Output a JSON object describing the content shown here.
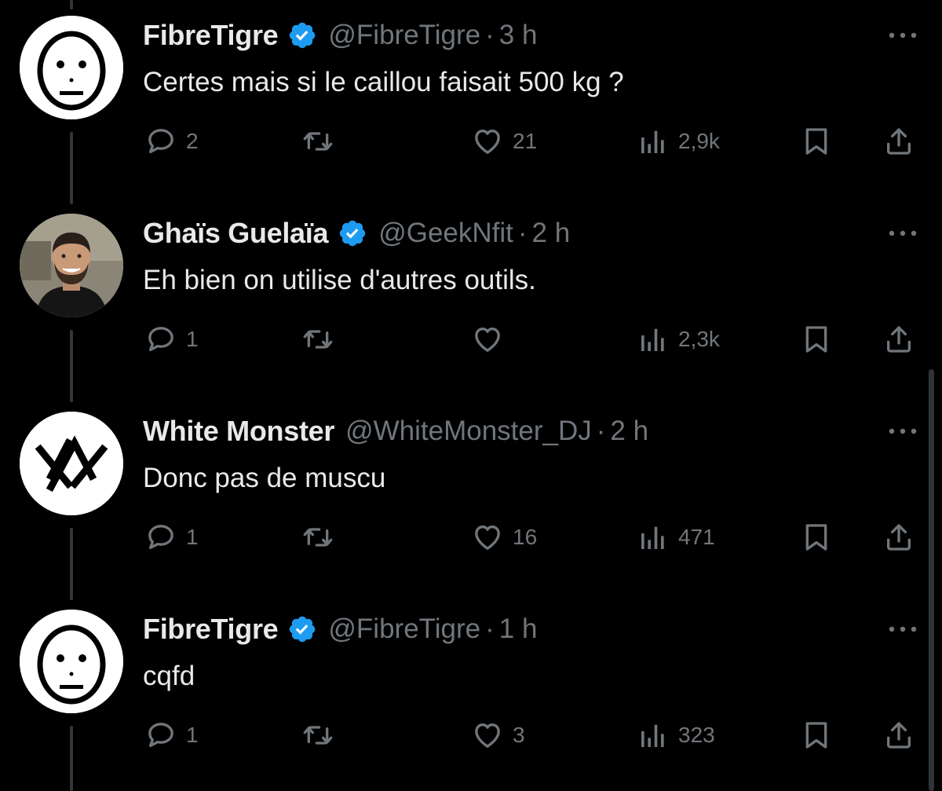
{
  "theme": {
    "background": "#000000",
    "text": "#e7e9ea",
    "muted": "#71767b",
    "verified": "#1d9bf0",
    "thread_line": "#333639"
  },
  "icons": {
    "reply": "speech-bubble-icon",
    "retweet": "retweet-icon",
    "like": "heart-icon",
    "views": "bar-chart-icon",
    "bookmark": "bookmark-icon",
    "share": "share-icon",
    "more": "more-dots-icon",
    "verified": "verified-badge-icon"
  },
  "tweets": [
    {
      "name": "FibreTigre",
      "verified": true,
      "handle": "@FibreTigre",
      "separator": "·",
      "time": "3 h",
      "text": "Certes mais si le caillou faisait 500 kg ?",
      "avatar": "face-mask-avatar",
      "replies": "2",
      "retweets": "",
      "likes": "21",
      "views": "2,9k"
    },
    {
      "name": "Ghaïs Guelaïa",
      "verified": true,
      "handle": "@GeekNfit",
      "separator": "·",
      "time": "2 h",
      "text": "Eh bien on utilise d'autres outils.",
      "avatar": "photo-avatar",
      "replies": "1",
      "retweets": "",
      "likes": "",
      "views": "2,3k"
    },
    {
      "name": "White Monster",
      "verified": false,
      "handle": "@WhiteMonster_DJ",
      "separator": "·",
      "time": "2 h",
      "text": "Donc pas de muscu",
      "avatar": "monster-logo-avatar",
      "replies": "1",
      "retweets": "",
      "likes": "16",
      "views": "471"
    },
    {
      "name": "FibreTigre",
      "verified": true,
      "handle": "@FibreTigre",
      "separator": "·",
      "time": "1 h",
      "text": "cqfd",
      "avatar": "face-mask-avatar",
      "replies": "1",
      "retweets": "",
      "likes": "3",
      "views": "323"
    }
  ]
}
